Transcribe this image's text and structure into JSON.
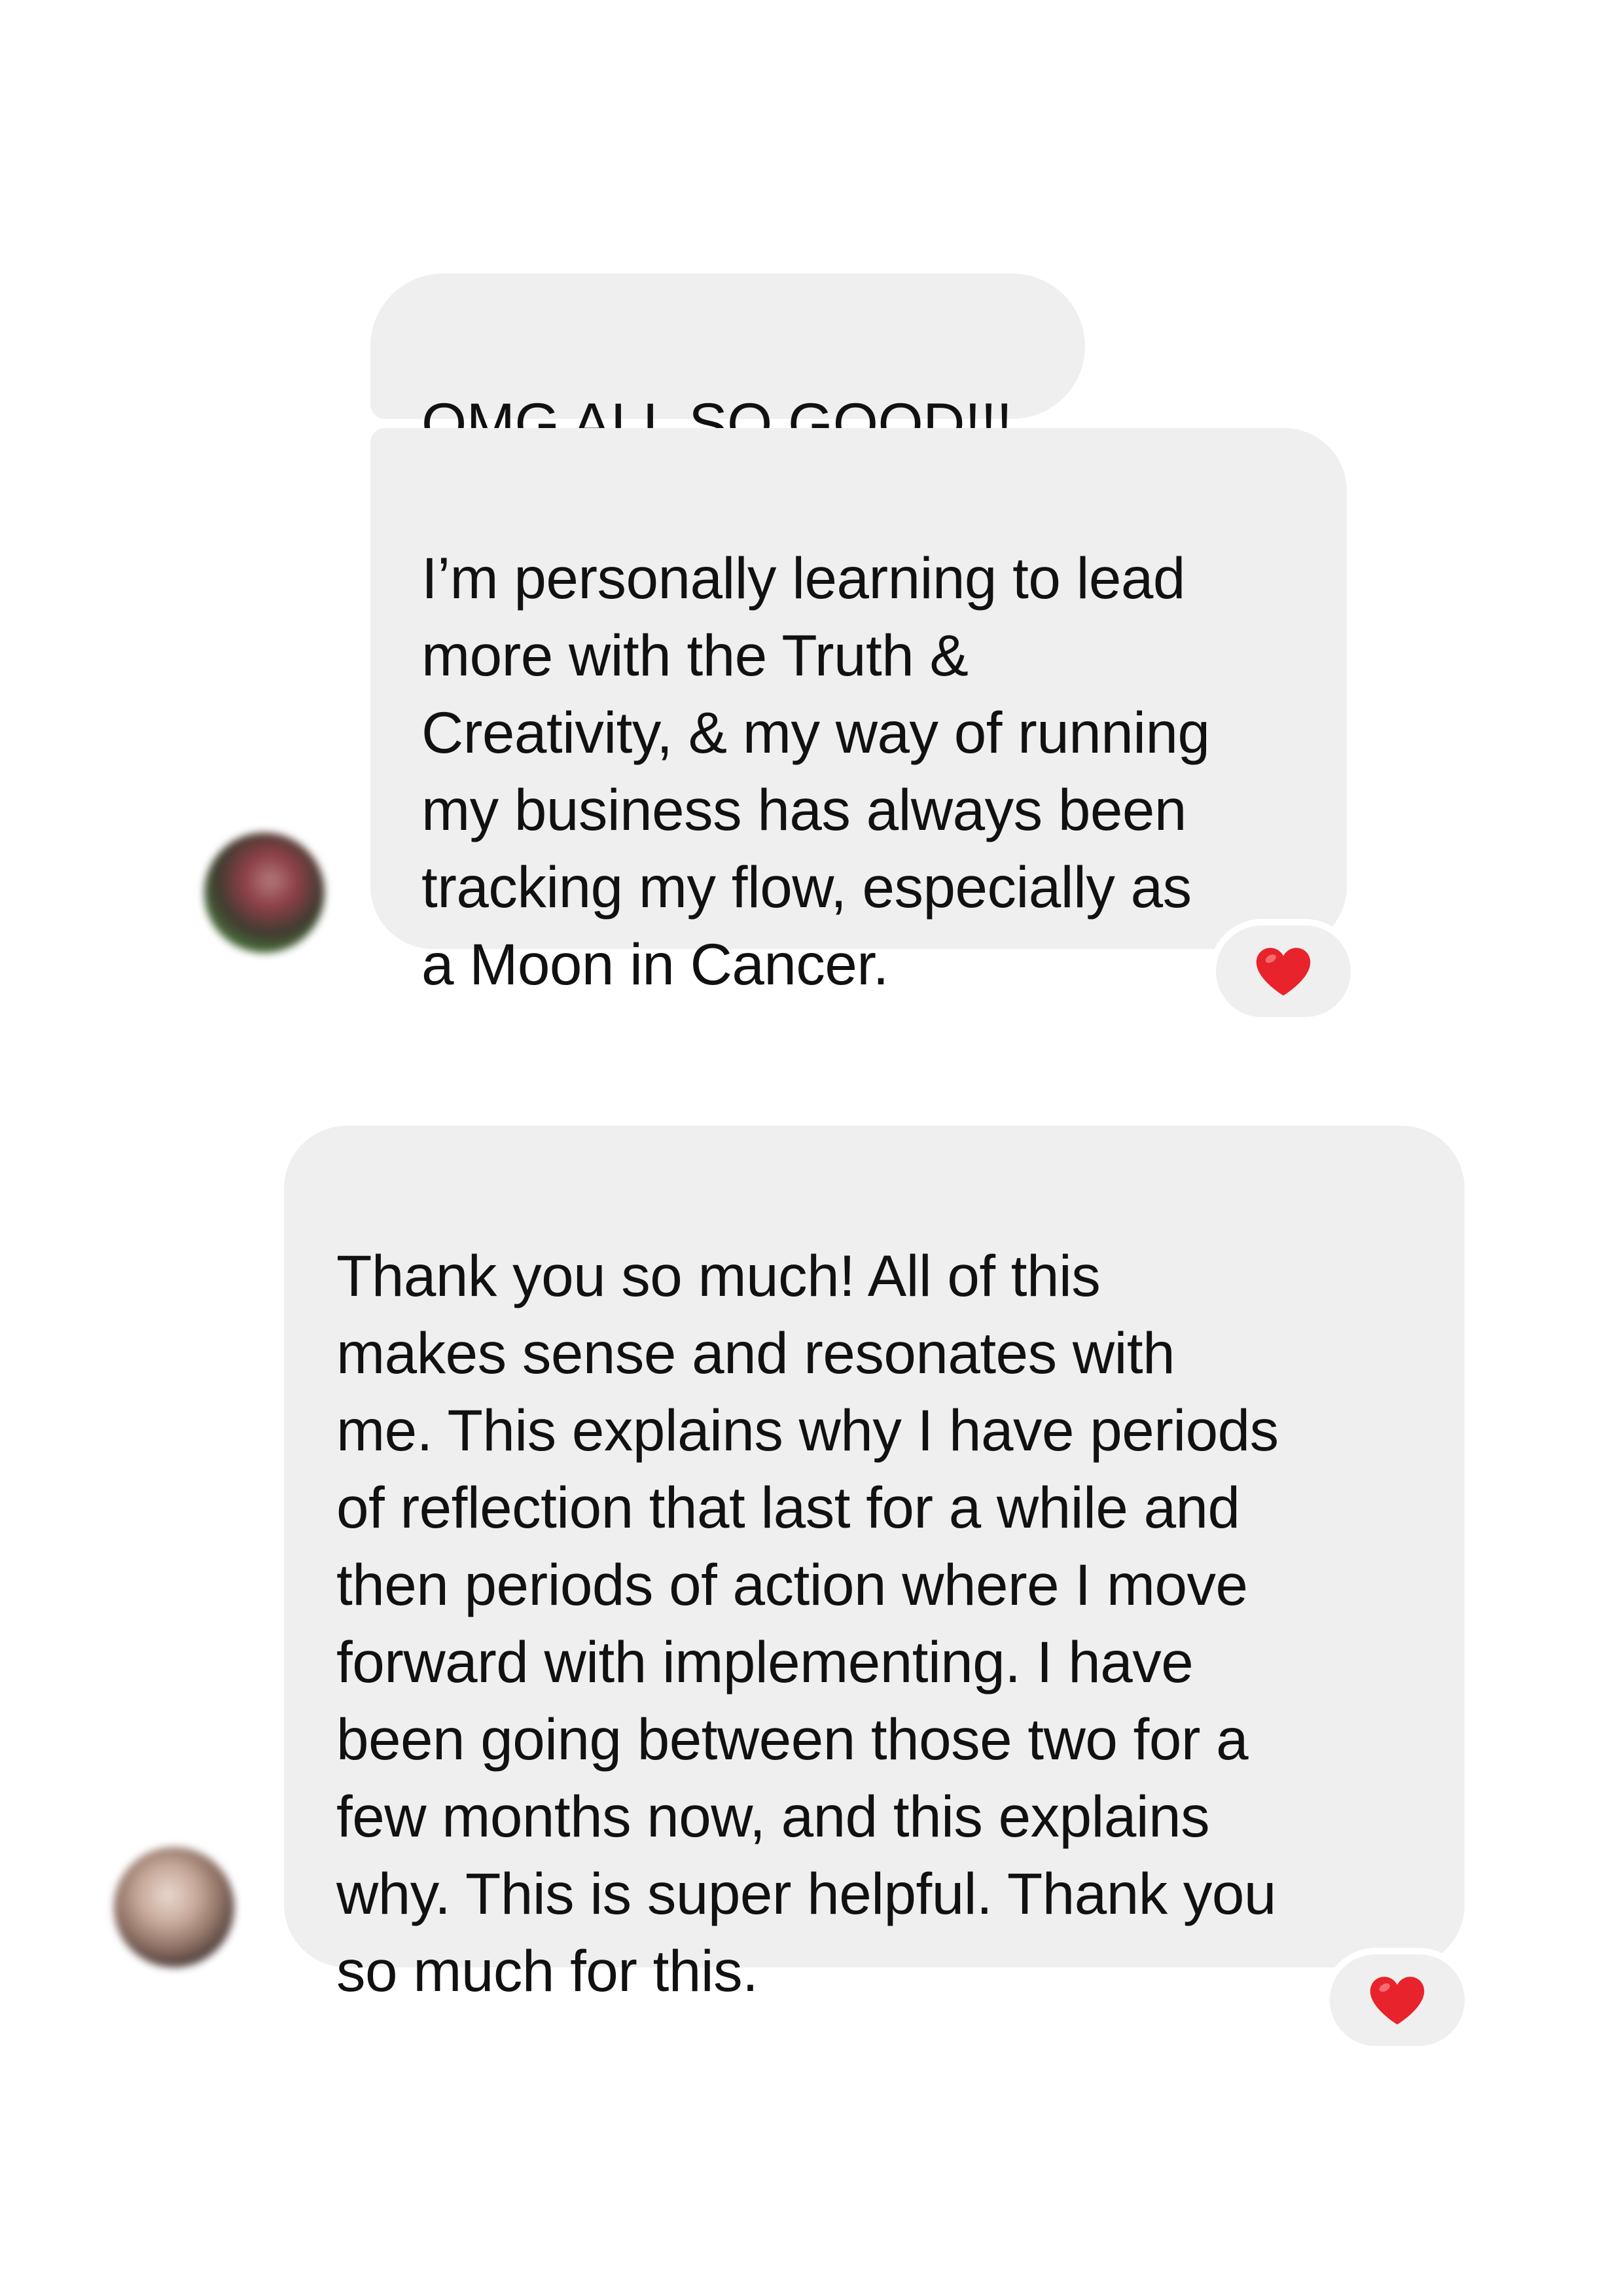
{
  "messages": [
    {
      "text": "OMG ALL SO GOOD!!!"
    },
    {
      "text": "I’m personally learning to lead\nmore with the Truth &\nCreativity, & my way of running\nmy business has always been\ntracking my flow, especially as\na Moon in Cancer."
    },
    {
      "text": "Thank you so much! All of this\nmakes sense and resonates with\nme. This explains why I have periods\nof reflection that last for a while and\nthen periods of action where I move\nforward with implementing. I have\nbeen going between those two for a\nfew months now, and this explains\nwhy. This is super helpful. Thank you\nso much for this."
    }
  ],
  "reactions": [
    {
      "icon": "heart-icon",
      "color": "#e8232b"
    },
    {
      "icon": "heart-icon",
      "color": "#e8232b"
    }
  ],
  "colors": {
    "bubble": "#efefef",
    "background": "#ffffff",
    "text": "#111111"
  }
}
